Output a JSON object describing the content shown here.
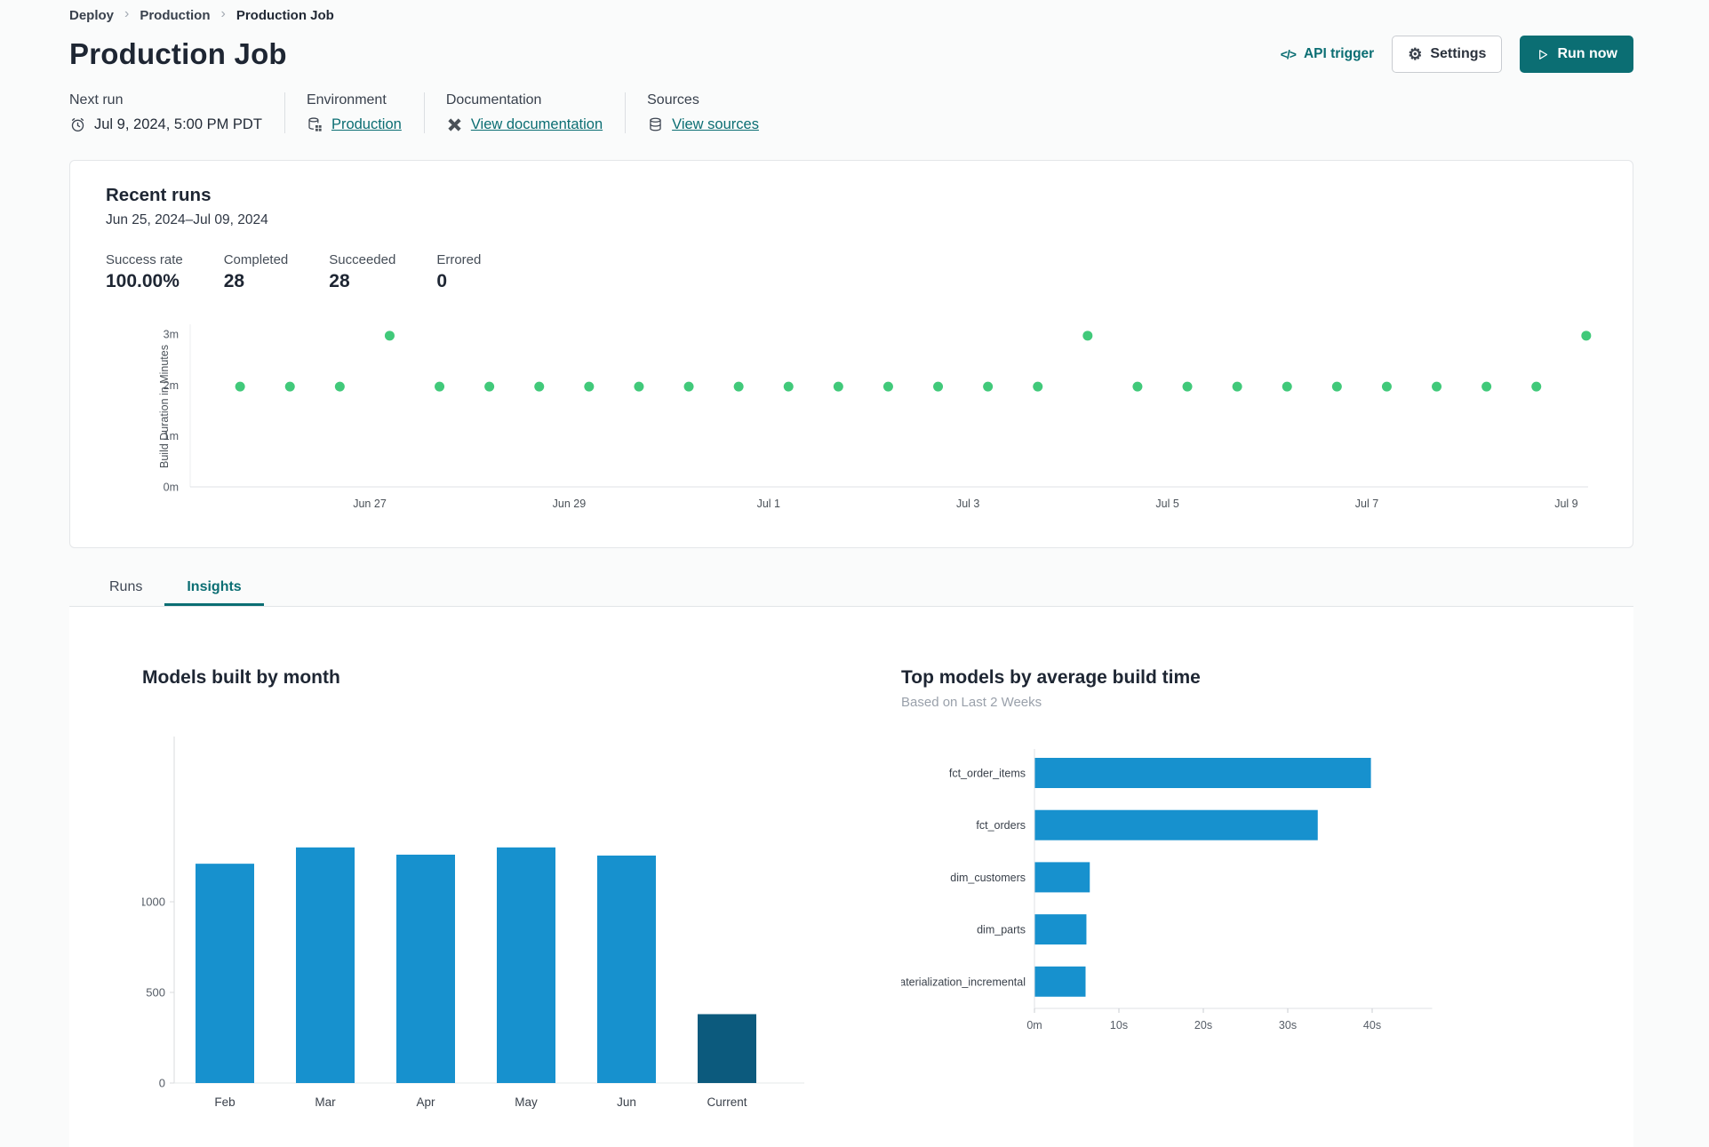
{
  "breadcrumb": {
    "items": [
      {
        "label": "Deploy"
      },
      {
        "label": "Production"
      },
      {
        "label": "Production Job"
      }
    ]
  },
  "header": {
    "title": "Production Job",
    "api_trigger": "API trigger",
    "settings": "Settings",
    "run_now": "Run now"
  },
  "meta": {
    "sections": [
      {
        "label": "Next run",
        "value": "Jul 9, 2024, 5:00 PM PDT",
        "icon": "alarm-clock-icon"
      },
      {
        "label": "Environment",
        "value": "Production",
        "icon": "environment-icon"
      },
      {
        "label": "Documentation",
        "value": "View documentation",
        "icon": "dbt-docs-icon"
      },
      {
        "label": "Sources",
        "value": "View sources",
        "icon": "database-icon"
      }
    ]
  },
  "recent_runs": {
    "title": "Recent runs",
    "date_range": "Jun 25, 2024–Jul 09, 2024",
    "stats": [
      {
        "label": "Success rate",
        "value": "100.00%"
      },
      {
        "label": "Completed",
        "value": "28"
      },
      {
        "label": "Succeeded",
        "value": "28"
      },
      {
        "label": "Errored",
        "value": "0"
      }
    ]
  },
  "tabs": {
    "items": [
      {
        "label": "Runs",
        "active": false
      },
      {
        "label": "Insights",
        "active": true
      }
    ]
  },
  "chart_data": [
    {
      "type": "scatter",
      "title": "Recent runs",
      "ylabel": "Build Duration in Minutes",
      "point_color": "#41c97a",
      "ylim": [
        0,
        3.25
      ],
      "y_ticks": [
        {
          "label": "0m",
          "value": 0
        },
        {
          "label": "1m",
          "value": 1
        },
        {
          "label": "2m",
          "value": 2
        },
        {
          "label": "3m",
          "value": 3
        }
      ],
      "x_ticks": [
        {
          "label": "Jun 27",
          "day": 2
        },
        {
          "label": "Jun 29",
          "day": 4
        },
        {
          "label": "Jul 1",
          "day": 6
        },
        {
          "label": "Jul 3",
          "day": 8
        },
        {
          "label": "Jul 5",
          "day": 10
        },
        {
          "label": "Jul 7",
          "day": 12
        },
        {
          "label": "Jul 9",
          "day": 14
        }
      ],
      "xlim_days": [
        0,
        14.25
      ],
      "points": [
        [
          0.7,
          1.97
        ],
        [
          1.2,
          1.97
        ],
        [
          1.7,
          1.97
        ],
        [
          2.2,
          2.97
        ],
        [
          2.7,
          1.97
        ],
        [
          3.2,
          1.97
        ],
        [
          3.7,
          1.97
        ],
        [
          4.2,
          1.97
        ],
        [
          4.7,
          1.97
        ],
        [
          5.2,
          1.97
        ],
        [
          5.7,
          1.97
        ],
        [
          6.2,
          1.97
        ],
        [
          6.7,
          1.97
        ],
        [
          7.2,
          1.97
        ],
        [
          7.7,
          1.97
        ],
        [
          8.2,
          1.97
        ],
        [
          8.7,
          1.97
        ],
        [
          9.2,
          2.97
        ],
        [
          9.7,
          1.97
        ],
        [
          10.2,
          1.97
        ],
        [
          10.7,
          1.97
        ],
        [
          11.2,
          1.97
        ],
        [
          11.7,
          1.97
        ],
        [
          12.2,
          1.97
        ],
        [
          12.7,
          1.97
        ],
        [
          13.2,
          1.97
        ],
        [
          13.7,
          1.97
        ],
        [
          14.2,
          2.97
        ]
      ]
    },
    {
      "type": "bar",
      "title": "Models built by month",
      "categories": [
        "Feb",
        "Mar",
        "Apr",
        "May",
        "Jun",
        "Current"
      ],
      "values": [
        1210,
        1300,
        1260,
        1300,
        1255,
        380
      ],
      "bar_colors": [
        "#1791ce",
        "#1791ce",
        "#1791ce",
        "#1791ce",
        "#1791ce",
        "#0c5a7d"
      ],
      "y_ticks": [
        0,
        500,
        1000
      ],
      "ylim": [
        0,
        1400
      ]
    },
    {
      "type": "horizontal_bar",
      "title": "Top models by average build time",
      "subtitle": "Based on Last 2 Weeks",
      "categories": [
        "fct_order_items",
        "fct_orders",
        "dim_customers",
        "dim_parts",
        "materialization_incremental"
      ],
      "values_seconds": [
        39.8,
        33.5,
        6.5,
        6.1,
        6.0
      ],
      "x_ticks": [
        {
          "label": "0m",
          "seconds": 0
        },
        {
          "label": "10s",
          "seconds": 10
        },
        {
          "label": "20s",
          "seconds": 20
        },
        {
          "label": "30s",
          "seconds": 30
        },
        {
          "label": "40s",
          "seconds": 40
        }
      ],
      "xlim_seconds": [
        0,
        45
      ],
      "bar_color": "#1791ce"
    }
  ],
  "colors": {
    "accent_teal": "#0b6e73",
    "page_background": "#fafbfb",
    "card_border": "#e4e6e9",
    "heading_text": "#1e2633",
    "success_green": "#41c97a",
    "bar_blue": "#1791ce",
    "bar_dark_blue": "#0c5a7d",
    "axis_text": "#555c66"
  }
}
